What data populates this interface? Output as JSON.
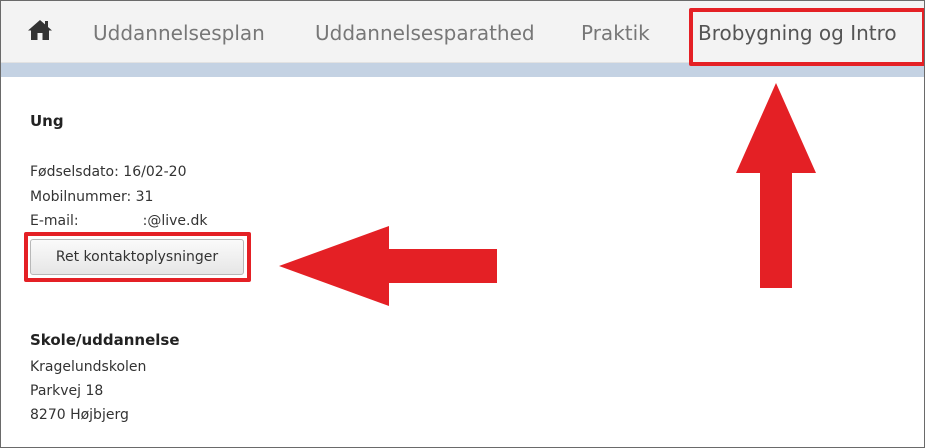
{
  "nav": {
    "home_icon": "home-icon",
    "items": [
      {
        "label": "Uddannelsesplan"
      },
      {
        "label": "Uddannelsesparathed"
      },
      {
        "label": "Praktik"
      },
      {
        "label": "Brobygning og Intro"
      }
    ]
  },
  "profile": {
    "heading": "Ung",
    "birthdate": "Fødselsdato: 16/02-20",
    "phone": "Mobilnummer: 31",
    "email_label": "E-mail:",
    "email_value": ":@live.dk",
    "edit_button": "Ret kontaktoplysninger"
  },
  "school": {
    "heading": "Skole/uddannelse",
    "name": "Kragelundskolen",
    "street": "Parkvej 18",
    "city": "8270 Højbjerg"
  },
  "annotation": {
    "color": "#e42025"
  }
}
